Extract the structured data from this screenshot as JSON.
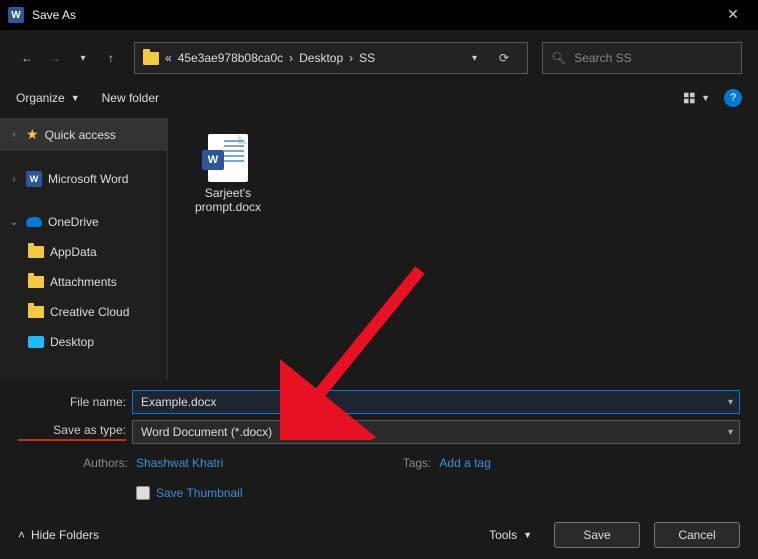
{
  "titlebar": {
    "app_glyph": "W",
    "title": "Save As"
  },
  "nav": {
    "breadcrumb": [
      "«",
      "45e3ae978b08ca0c",
      "Desktop",
      "SS"
    ],
    "search_placeholder": "Search SS"
  },
  "toolbar": {
    "organize": "Organize",
    "new_folder": "New folder"
  },
  "sidebar": {
    "quick_access": "Quick access",
    "msword": "Microsoft Word",
    "onedrive": "OneDrive",
    "children": [
      "AppData",
      "Attachments",
      "Creative Cloud",
      "Desktop"
    ]
  },
  "files": {
    "item1": "Sarjeet's prompt.docx"
  },
  "form": {
    "file_name_label": "File name:",
    "file_name_value": "Example.docx",
    "save_as_type_label": "Save as type:",
    "save_as_type_value": "Word Document (*.docx)",
    "authors_label": "Authors:",
    "authors_value": "Shashwat Khatri",
    "tags_label": "Tags:",
    "tags_value": "Add a tag",
    "save_thumbnail": "Save Thumbnail"
  },
  "footer": {
    "hide_folders": "Hide Folders",
    "tools": "Tools",
    "save": "Save",
    "cancel": "Cancel"
  }
}
